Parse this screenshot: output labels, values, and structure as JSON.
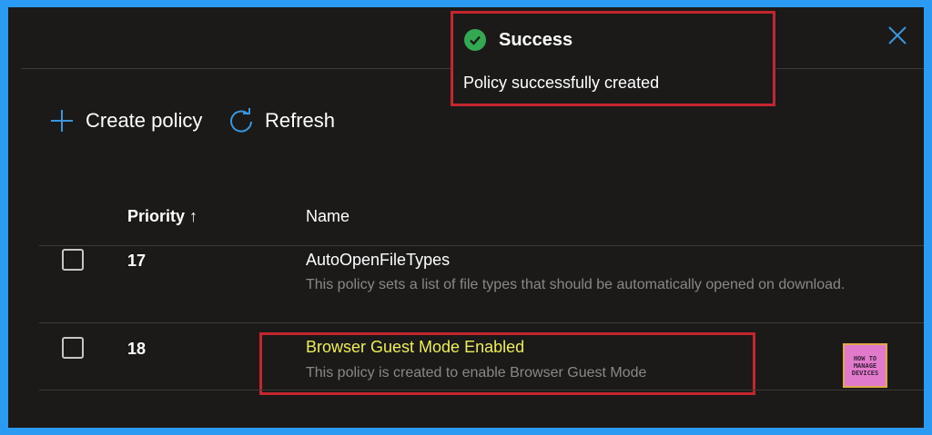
{
  "toast": {
    "icon": "check-circle-icon",
    "title": "Success",
    "message": "Policy successfully created"
  },
  "close_icon": "close-icon",
  "toolbar": {
    "create_label": "Create policy",
    "create_icon": "plus-icon",
    "refresh_label": "Refresh",
    "refresh_icon": "refresh-icon"
  },
  "table": {
    "columns": [
      "Priority ↑",
      "Name"
    ],
    "rows": [
      {
        "priority": "17",
        "name": "AutoOpenFileTypes",
        "description": "This policy sets a list of file types that should be automatically opened on download."
      },
      {
        "priority": "18",
        "name": "Browser Guest Mode Enabled",
        "description": "This policy is created to enable Browser Guest Mode"
      }
    ]
  },
  "logo": {
    "line1": "HOW TO",
    "line2": "MANAGE",
    "line3": "DEVICES"
  },
  "colors": {
    "accent": "#2b9af3",
    "highlight": "#eeee55",
    "callout_border": "#c4262e",
    "success": "#34a853",
    "background": "#1b1a19"
  }
}
